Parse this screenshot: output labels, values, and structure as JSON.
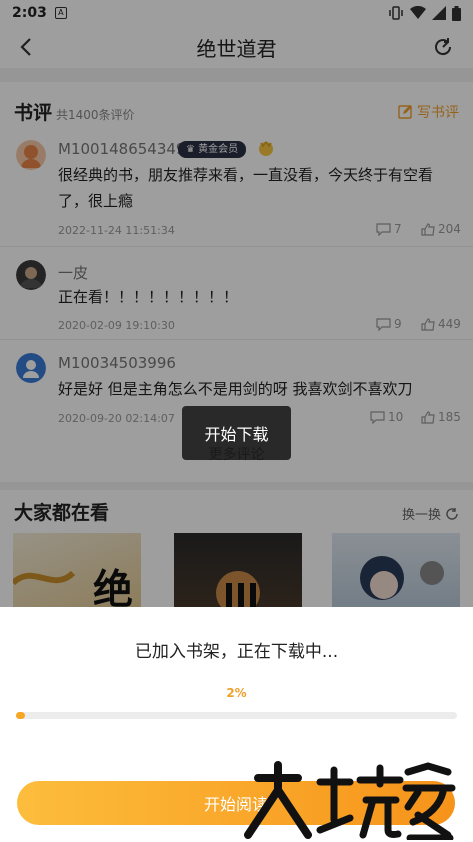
{
  "status_bar": {
    "time": "2:03",
    "notif_icon": "A"
  },
  "app_bar": {
    "title": "绝世道君"
  },
  "reviews_section": {
    "title": "书评",
    "count_text": "共1400条评价",
    "write_label": "写书评",
    "reviews": [
      {
        "user": "M100148654349",
        "badge": "黄金会员",
        "text": "很经典的书，朋友推荐来看，一直没看，今天终于有空看了，很上瘾",
        "date": "2022-11-24 11:51:34",
        "comments": "7",
        "likes": "204"
      },
      {
        "user": "一皮",
        "text": "正在看！！！！！！！！！",
        "date": "2020-02-09 19:10:30",
        "comments": "9",
        "likes": "449"
      },
      {
        "user": "M10034503996",
        "text": "好是好  但是主角怎么不是用剑的呀  我喜欢剑不喜欢刀",
        "date": "2020-09-20 02:14:07",
        "comments": "10",
        "likes": "185"
      }
    ],
    "more_label": "更多评论"
  },
  "popular_section": {
    "title": "大家都在看",
    "shuffle_label": "换一换",
    "cover_char": "绝"
  },
  "toast": {
    "text": "开始下载"
  },
  "download_sheet": {
    "message": "已加入书架，正在下载中...",
    "progress_label": "2%",
    "progress": 0.02,
    "button_label": "开始阅读"
  },
  "watermark": {
    "text": "大玩家"
  },
  "colors": {
    "accent": "#f5a623",
    "badge_bg": "#2a2f45"
  }
}
